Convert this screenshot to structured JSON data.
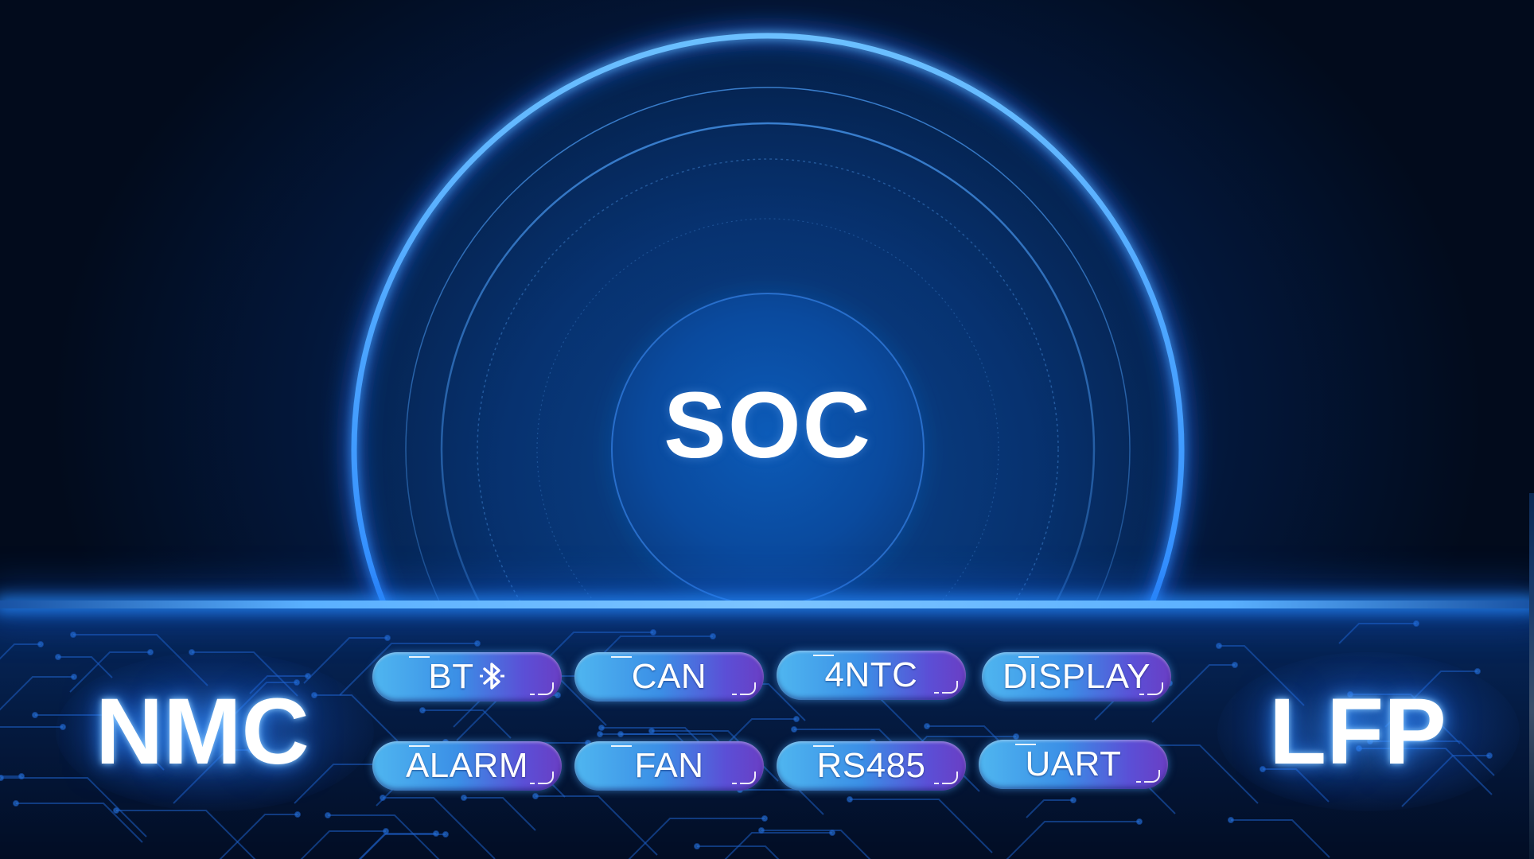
{
  "center": {
    "title": "SOC"
  },
  "batteries": {
    "left": "NMC",
    "right": "LFP"
  },
  "features": [
    {
      "label": "BT",
      "icon": "bluetooth-icon"
    },
    {
      "label": "CAN"
    },
    {
      "label": "4NTC"
    },
    {
      "label": "DISPLAY"
    },
    {
      "label": "ALARM"
    },
    {
      "label": "FAN"
    },
    {
      "label": "RS485"
    },
    {
      "label": "UART"
    }
  ],
  "colors": {
    "background": "#020b1c",
    "glow_blue": "#3a8cff",
    "pill_start": "#4fb6f0",
    "pill_end": "#6a3ec4",
    "text": "#ffffff"
  }
}
